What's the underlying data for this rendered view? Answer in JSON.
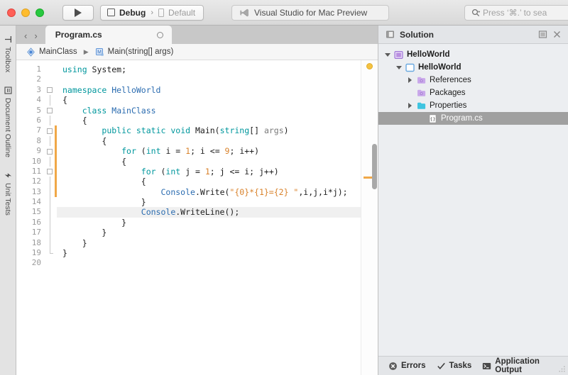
{
  "window": {
    "traffic_lights": [
      "close",
      "minimize",
      "zoom"
    ],
    "status_title": "Visual Studio for Mac Preview",
    "status_icon": "vs-logo-icon"
  },
  "toolbar": {
    "run_button_icon": "play-icon",
    "configuration": "Debug",
    "separator": "›",
    "target": "Default",
    "config_icon": "square-icon",
    "target_icon": "device-icon",
    "search_icon": "search-icon",
    "search_placeholder": "Press ‘⌘.’ to sea"
  },
  "rail": {
    "items": [
      {
        "label": "Toolbox",
        "icon": "toolbox-icon"
      },
      {
        "label": "Document Outline",
        "icon": "outline-icon"
      },
      {
        "label": "Unit Tests",
        "icon": "unit-tests-icon"
      }
    ]
  },
  "tabstrip": {
    "back_arrow": "‹",
    "forward_arrow": "›",
    "tabs": [
      {
        "title": "Program.cs",
        "close_icon": "close-circle-icon",
        "active": true
      }
    ]
  },
  "breadcrumb": {
    "items": [
      {
        "label": "MainClass",
        "icon": "class-icon"
      },
      {
        "label": "Main(string[] args)",
        "icon": "method-icon"
      }
    ],
    "separator": "▶"
  },
  "editor": {
    "line_count": 20,
    "active_line": 15,
    "line_numbers": [
      1,
      2,
      3,
      4,
      5,
      6,
      7,
      8,
      9,
      10,
      11,
      12,
      13,
      14,
      15,
      16,
      17,
      18,
      19,
      20
    ],
    "lines": [
      {
        "n": 1,
        "tokens": [
          {
            "t": "using",
            "c": "kw"
          },
          {
            "t": " System;",
            "c": "plain"
          }
        ]
      },
      {
        "n": 2,
        "tokens": []
      },
      {
        "n": 3,
        "tokens": [
          {
            "t": "namespace",
            "c": "kw"
          },
          {
            "t": " ",
            "c": "plain"
          },
          {
            "t": "HelloWorld",
            "c": "type"
          }
        ]
      },
      {
        "n": 4,
        "tokens": [
          {
            "t": "{",
            "c": "plain"
          }
        ]
      },
      {
        "n": 5,
        "tokens": [
          {
            "t": "    ",
            "c": "plain"
          },
          {
            "t": "class",
            "c": "kw"
          },
          {
            "t": " ",
            "c": "plain"
          },
          {
            "t": "MainClass",
            "c": "type"
          }
        ]
      },
      {
        "n": 6,
        "tokens": [
          {
            "t": "    {",
            "c": "plain"
          }
        ]
      },
      {
        "n": 7,
        "tokens": [
          {
            "t": "        ",
            "c": "plain"
          },
          {
            "t": "public",
            "c": "kw"
          },
          {
            "t": " ",
            "c": "plain"
          },
          {
            "t": "static",
            "c": "kw"
          },
          {
            "t": " ",
            "c": "plain"
          },
          {
            "t": "void",
            "c": "kw"
          },
          {
            "t": " Main(",
            "c": "plain"
          },
          {
            "t": "string",
            "c": "kw"
          },
          {
            "t": "[] ",
            "c": "plain"
          },
          {
            "t": "args",
            "c": "param"
          },
          {
            "t": ")",
            "c": "plain"
          }
        ]
      },
      {
        "n": 8,
        "tokens": [
          {
            "t": "        {",
            "c": "plain"
          }
        ]
      },
      {
        "n": 9,
        "tokens": [
          {
            "t": "            ",
            "c": "plain"
          },
          {
            "t": "for",
            "c": "kw"
          },
          {
            "t": " (",
            "c": "plain"
          },
          {
            "t": "int",
            "c": "kw"
          },
          {
            "t": " i = ",
            "c": "plain"
          },
          {
            "t": "1",
            "c": "num"
          },
          {
            "t": "; i <= ",
            "c": "plain"
          },
          {
            "t": "9",
            "c": "num"
          },
          {
            "t": "; i++)",
            "c": "plain"
          }
        ]
      },
      {
        "n": 10,
        "tokens": [
          {
            "t": "            {",
            "c": "plain"
          }
        ]
      },
      {
        "n": 11,
        "tokens": [
          {
            "t": "                ",
            "c": "plain"
          },
          {
            "t": "for",
            "c": "kw"
          },
          {
            "t": " (",
            "c": "plain"
          },
          {
            "t": "int",
            "c": "kw"
          },
          {
            "t": " j = ",
            "c": "plain"
          },
          {
            "t": "1",
            "c": "num"
          },
          {
            "t": "; j <= i; j++)",
            "c": "plain"
          }
        ]
      },
      {
        "n": 12,
        "tokens": [
          {
            "t": "                {",
            "c": "plain"
          }
        ]
      },
      {
        "n": 13,
        "tokens": [
          {
            "t": "                    ",
            "c": "plain"
          },
          {
            "t": "Console",
            "c": "type"
          },
          {
            "t": ".Write(",
            "c": "plain"
          },
          {
            "t": "\"{0}*{1}={2} \"",
            "c": "str"
          },
          {
            "t": ",i,j,i*j);",
            "c": "plain"
          }
        ]
      },
      {
        "n": 14,
        "tokens": [
          {
            "t": "                }",
            "c": "plain"
          }
        ]
      },
      {
        "n": 15,
        "tokens": [
          {
            "t": "                ",
            "c": "plain"
          },
          {
            "t": "Console",
            "c": "type"
          },
          {
            "t": ".WriteLine();",
            "c": "plain"
          }
        ]
      },
      {
        "n": 16,
        "tokens": [
          {
            "t": "            }",
            "c": "plain"
          }
        ]
      },
      {
        "n": 17,
        "tokens": [
          {
            "t": "        }",
            "c": "plain"
          }
        ]
      },
      {
        "n": 18,
        "tokens": [
          {
            "t": "    }",
            "c": "plain"
          }
        ]
      },
      {
        "n": 19,
        "tokens": [
          {
            "t": "}",
            "c": "plain"
          }
        ]
      },
      {
        "n": 20,
        "tokens": []
      }
    ],
    "fold_lines": [
      3,
      5,
      7,
      9,
      11
    ],
    "change_bar_lines": [
      7,
      8,
      9,
      10,
      11,
      12,
      13
    ],
    "markers": {
      "warning_dot": true,
      "warning_line_row": 12
    },
    "colors": {
      "keyword": "#00979d",
      "type": "#2b6cb0",
      "number": "#d9822b",
      "string": "#d9822b",
      "plain": "#1c1c1c",
      "active_line_bg": "#f0f0f0",
      "change_bar": "#f0a848",
      "marker_dot": "#f5c242"
    }
  },
  "solution": {
    "title": "Solution",
    "header_icon": "solution-pad-icon",
    "pin_icon": "pin-icon",
    "close_icon": "close-icon",
    "tree": [
      {
        "label": "HelloWorld",
        "icon": "solution-icon",
        "depth": 0,
        "twisty": "down",
        "bold": true,
        "selected": false
      },
      {
        "label": "HelloWorld",
        "icon": "project-icon",
        "depth": 1,
        "twisty": "down",
        "bold": true,
        "selected": false
      },
      {
        "label": "References",
        "icon": "references-icon",
        "depth": 2,
        "twisty": "right",
        "bold": false,
        "selected": false
      },
      {
        "label": "Packages",
        "icon": "packages-icon",
        "depth": 2,
        "twisty": "none",
        "bold": false,
        "selected": false
      },
      {
        "label": "Properties",
        "icon": "folder-icon",
        "depth": 2,
        "twisty": "right",
        "bold": false,
        "selected": false
      },
      {
        "label": "Program.cs",
        "icon": "csharp-file-icon",
        "depth": 3,
        "twisty": "none",
        "bold": false,
        "selected": true
      }
    ]
  },
  "statusbar": {
    "items": [
      {
        "label": "Errors",
        "icon": "error-icon"
      },
      {
        "label": "Tasks",
        "icon": "check-icon"
      },
      {
        "label": "Application Output",
        "icon": "terminal-icon"
      }
    ],
    "resize_grip": "resize-grip-icon"
  }
}
